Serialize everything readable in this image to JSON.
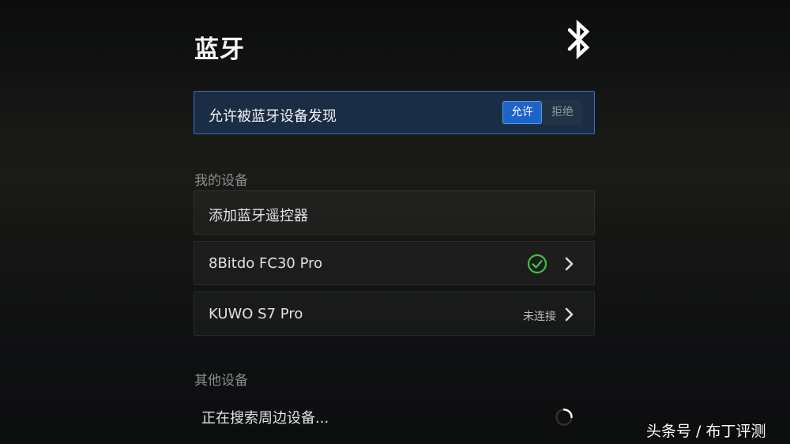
{
  "header": {
    "title": "蓝牙",
    "icon": "bluetooth-icon"
  },
  "discoverable": {
    "label": "允许被蓝牙设备发现",
    "options": [
      "允许",
      "拒绝"
    ],
    "selected": "允许",
    "accent_color": "#1d64c8"
  },
  "my_devices": {
    "section_title": "我的设备",
    "add_remote_label": "添加蓝牙遥控器",
    "devices": [
      {
        "name": "8Bitdo FC30 Pro",
        "status": "connected",
        "status_icon": "check-circle-icon",
        "status_color": "#3fbf4a"
      },
      {
        "name": "KUWO S7 Pro",
        "status_text": "未连接"
      }
    ]
  },
  "other_devices": {
    "section_title": "其他设备",
    "searching_label": "正在搜索周边设备...",
    "spinner_icon": "loading-spinner-icon"
  },
  "watermark": "头条号 / 布丁评测"
}
